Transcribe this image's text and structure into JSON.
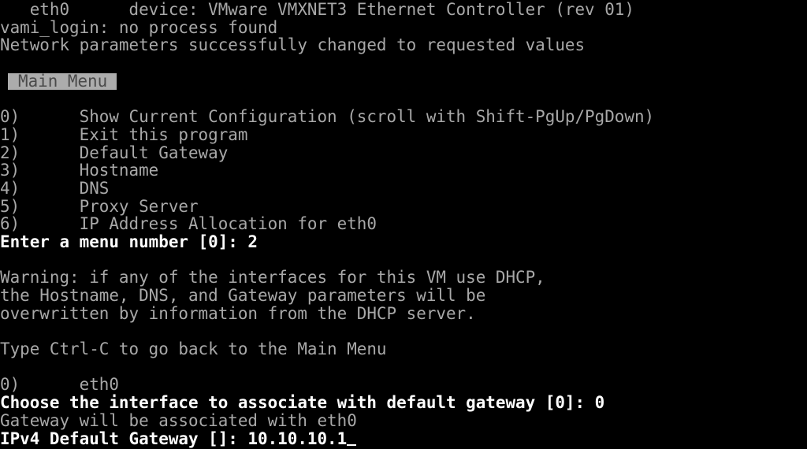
{
  "terminal": {
    "lines": [
      {
        "text": "   eth0      device: VMware VMXNET3 Ethernet Controller (rev 01)",
        "style": "normal"
      },
      {
        "text": "vami_login: no process found",
        "style": "normal"
      },
      {
        "text": "Network parameters successfully changed to requested values",
        "style": "normal"
      },
      {
        "text": "",
        "style": "normal"
      },
      {
        "text": "Main Menu",
        "style": "highlight"
      },
      {
        "text": "",
        "style": "normal"
      },
      {
        "text": "0)      Show Current Configuration (scroll with Shift-PgUp/PgDown)",
        "style": "normal"
      },
      {
        "text": "1)      Exit this program",
        "style": "normal"
      },
      {
        "text": "2)      Default Gateway",
        "style": "normal"
      },
      {
        "text": "3)      Hostname",
        "style": "normal"
      },
      {
        "text": "4)      DNS",
        "style": "normal"
      },
      {
        "text": "5)      Proxy Server",
        "style": "normal"
      },
      {
        "text": "6)      IP Address Allocation for eth0",
        "style": "normal"
      },
      {
        "text": "Enter a menu number [0]: 2",
        "style": "bright"
      },
      {
        "text": "",
        "style": "normal"
      },
      {
        "text": "Warning: if any of the interfaces for this VM use DHCP,",
        "style": "normal"
      },
      {
        "text": "the Hostname, DNS, and Gateway parameters will be",
        "style": "normal"
      },
      {
        "text": "overwritten by information from the DHCP server.",
        "style": "normal"
      },
      {
        "text": "",
        "style": "normal"
      },
      {
        "text": "Type Ctrl-C to go back to the Main Menu",
        "style": "normal"
      },
      {
        "text": "",
        "style": "normal"
      },
      {
        "text": "0)      eth0",
        "style": "normal"
      },
      {
        "text": "Choose the interface to associate with default gateway [0]: 0",
        "style": "bright"
      },
      {
        "text": "Gateway will be associated with eth0",
        "style": "normal"
      },
      {
        "text": "IPv4 Default Gateway []: 10.10.10.1",
        "style": "bright",
        "cursor": true
      }
    ]
  },
  "colors": {
    "background": "#000000",
    "text": "#a8a8a8",
    "bright": "#ffffff",
    "highlight_bg": "#acacac"
  }
}
